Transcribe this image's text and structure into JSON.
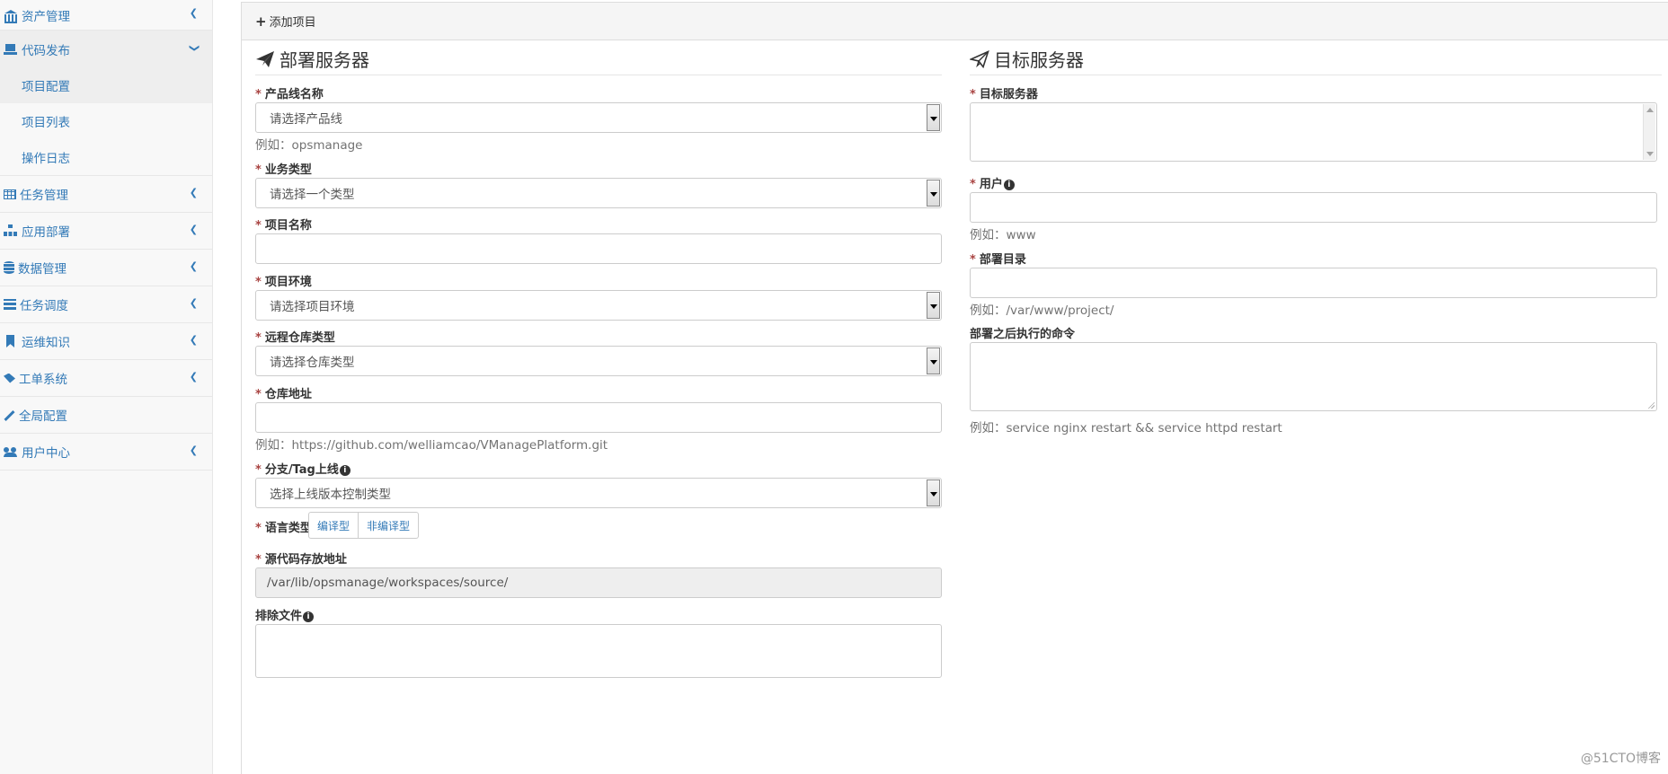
{
  "sidebar": {
    "items": [
      {
        "label": "资产管理",
        "icon": "bank-icon"
      },
      {
        "label": "代码发布",
        "icon": "laptop-icon",
        "open": true,
        "subitems": [
          "项目配置",
          "项目列表",
          "操作日志"
        ]
      },
      {
        "label": "任务管理",
        "icon": "table-icon"
      },
      {
        "label": "应用部署",
        "icon": "sitemap-icon"
      },
      {
        "label": "数据管理",
        "icon": "database-icon"
      },
      {
        "label": "任务调度",
        "icon": "tasks-icon"
      },
      {
        "label": "运维知识",
        "icon": "bookmark-icon"
      },
      {
        "label": "工单系统",
        "icon": "tag-icon"
      },
      {
        "label": "全局配置",
        "icon": "wrench-icon"
      },
      {
        "label": "用户中心",
        "icon": "users-icon"
      }
    ]
  },
  "panel": {
    "heading": "添加项目"
  },
  "deploy": {
    "title": "部署服务器",
    "product_line": {
      "label": "产品线名称",
      "placeholder": "请选择产品线",
      "help": "例如：opsmanage"
    },
    "business_type": {
      "label": "业务类型",
      "placeholder": "请选择一个类型"
    },
    "project_name": {
      "label": "项目名称",
      "value": ""
    },
    "project_env": {
      "label": "项目环境",
      "placeholder": "请选择项目环境"
    },
    "repo_type": {
      "label": "远程仓库类型",
      "placeholder": "请选择仓库类型"
    },
    "repo_url": {
      "label": "仓库地址",
      "value": "",
      "help": "例如：https://github.com/welliamcao/VManagePlatform.git"
    },
    "branch_tag": {
      "label": "分支/Tag上线",
      "placeholder": "选择上线版本控制类型"
    },
    "language": {
      "label": "语言类型:",
      "options": [
        "编译型",
        "非编译型"
      ]
    },
    "source_dir": {
      "label": "源代码存放地址",
      "value": "/var/lib/opsmanage/workspaces/source/"
    },
    "exclude": {
      "label": "排除文件",
      "value": ""
    }
  },
  "target": {
    "title": "目标服务器",
    "servers": {
      "label": "目标服务器"
    },
    "user": {
      "label": "用户",
      "value": "",
      "help": "例如：www"
    },
    "deploy_dir": {
      "label": "部署目录",
      "value": "",
      "help": "例如：/var/www/project/"
    },
    "post_cmd": {
      "label": "部署之后执行的命令",
      "value": "",
      "help": "例如：service nginx restart && service httpd restart"
    }
  },
  "watermark": "@51CTO博客",
  "colors": {
    "link": "#337ab7",
    "required": "#a94442",
    "help": "#737373"
  }
}
